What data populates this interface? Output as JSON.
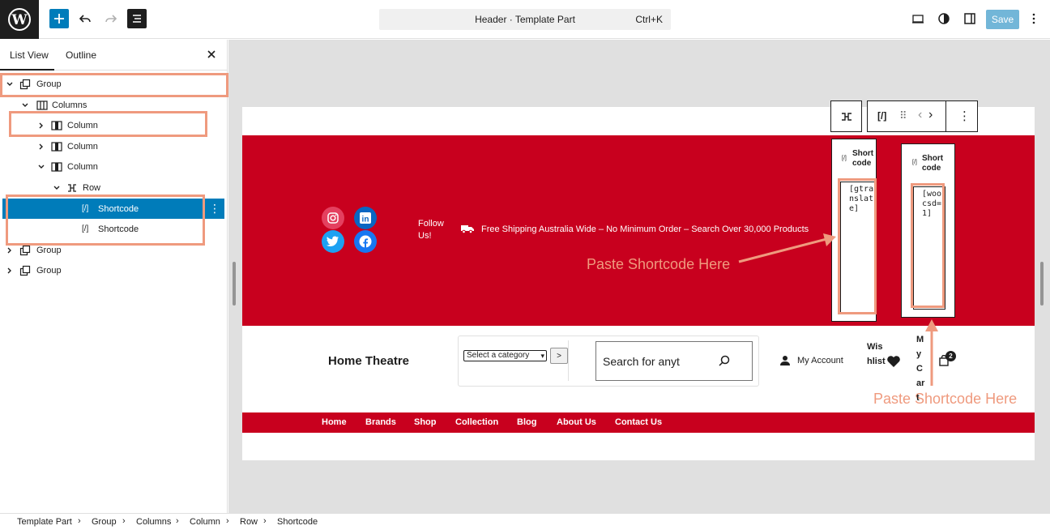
{
  "topbar": {
    "command_title": "Header · Template Part",
    "command_shortcut": "Ctrl+K",
    "save_label": "Save"
  },
  "sidebar": {
    "tabs": [
      "List View",
      "Outline"
    ],
    "items": [
      {
        "label": "Group",
        "expanded": true
      },
      {
        "label": "Columns",
        "expanded": true
      },
      {
        "label": "Column",
        "expanded": false
      },
      {
        "label": "Column",
        "expanded": false
      },
      {
        "label": "Column",
        "expanded": true
      },
      {
        "label": "Row",
        "expanded": true
      },
      {
        "label": "Shortcode",
        "selected": true
      },
      {
        "label": "Shortcode"
      },
      {
        "label": "Group",
        "expanded": false
      },
      {
        "label": "Group",
        "expanded": false
      }
    ]
  },
  "header_preview": {
    "follow_label": "Follow Us!",
    "shipping_text": "Free Shipping Australia Wide – No Minimum Order – Search Over 30,000 Products",
    "shortcode_card_title": "Short code",
    "shortcode1_value": "[gtranslate]",
    "shortcode2_value": "[woocsd=1]",
    "annotation_1": "Paste Shortcode Here",
    "annotation_2": "Paste Shortcode Here",
    "site_title": "Home Theatre",
    "category_select": "Select a category",
    "category_submit": ">",
    "search_value": "Search for anyt",
    "account_label": "My Account",
    "wishlist_label": "Wishlist",
    "cart_label": "My Cart",
    "cart_count": "2",
    "nav": [
      "Home",
      "Brands",
      "Shop",
      "Collection",
      "Blog",
      "About Us",
      "Contact Us"
    ]
  },
  "breadcrumb": [
    "Template Part",
    "Group",
    "Columns",
    "Column",
    "Row",
    "Shortcode"
  ],
  "colors": {
    "accent": "#007cba",
    "brand_red": "#c8001e",
    "annotation": "#ef9a7e"
  }
}
